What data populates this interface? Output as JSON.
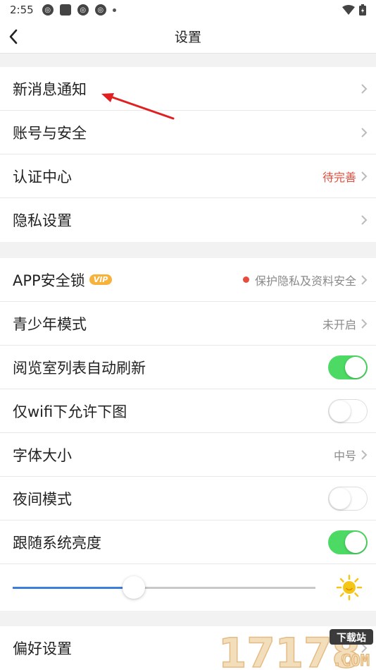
{
  "status_bar": {
    "time": "2:55"
  },
  "header": {
    "title": "设置"
  },
  "group1": [
    {
      "label": "新消息通知",
      "value": ""
    },
    {
      "label": "账号与安全",
      "value": ""
    },
    {
      "label": "认证中心",
      "value": "待完善"
    },
    {
      "label": "隐私设置",
      "value": ""
    }
  ],
  "group2": {
    "app_lock": {
      "label": "APP安全锁",
      "badge": "VIP",
      "value": "保护隐私及资料安全"
    },
    "teen_mode": {
      "label": "青少年模式",
      "value": "未开启"
    },
    "auto_refresh": {
      "label": "阅览室列表自动刷新",
      "on": true
    },
    "wifi_download": {
      "label": "仅wifi下允许下图",
      "on": false
    },
    "font_size": {
      "label": "字体大小",
      "value": "中号"
    },
    "night_mode": {
      "label": "夜间模式",
      "on": false
    },
    "follow_brightness": {
      "label": "跟随系统亮度",
      "on": true
    },
    "brightness_level": 0.4
  },
  "group3": [
    {
      "label": "偏好设置"
    }
  ],
  "watermark": {
    "text": "17178",
    "badge": "下载站",
    "sub": ".COM"
  },
  "colors": {
    "accent_green": "#4cd964",
    "slider_blue": "#3d7ddb",
    "warn_red": "#e74c3c"
  }
}
